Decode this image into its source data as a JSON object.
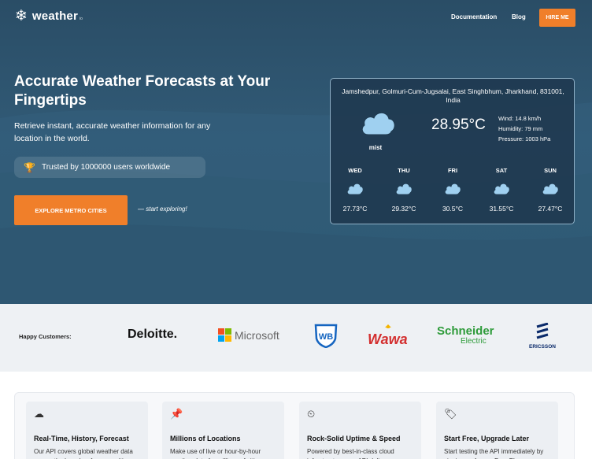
{
  "header": {
    "logo_text": "weather",
    "logo_suffix": "io",
    "nav": [
      "Documentation",
      "Blog"
    ],
    "cta": "HIRE ME"
  },
  "hero": {
    "title": "Accurate Weather Forecasts at Your Fingertips",
    "subtitle": "Retrieve instant, accurate weather information for any location in the world.",
    "trust_text": "Trusted by 1000000 users worldwide",
    "explore_button": "EXPLORE METRO CITIES",
    "explore_note": "— start exploring!"
  },
  "weather_card": {
    "location": "Jamshedpur, Golmuri-Cum-Jugsalai, East Singhbhum, Jharkhand, 831001, India",
    "condition": "mist",
    "temperature": "28.95°C",
    "wind": "Wind: 14.8 km/h",
    "humidity": "Humidity: 79 mm",
    "pressure": "Pressure: 1003 hPa",
    "forecast": [
      {
        "day": "WED",
        "temp": "27.73°C",
        "icon": "cloud-icon"
      },
      {
        "day": "THU",
        "temp": "29.32°C",
        "icon": "cloud-icon"
      },
      {
        "day": "FRI",
        "temp": "30.5°C",
        "icon": "cloud-icon"
      },
      {
        "day": "SAT",
        "temp": "31.55°C",
        "icon": "cloud-icon"
      },
      {
        "day": "SUN",
        "temp": "27.47°C",
        "icon": "cloud-icon"
      }
    ]
  },
  "customers": {
    "label": "Happy Customers:",
    "brands": [
      "Deloitte.",
      "Microsoft",
      "WB",
      "Wawa",
      "Schneider",
      "Electric",
      "ERICSSON"
    ]
  },
  "features": [
    {
      "icon": "cloud-clock-icon",
      "title": "Real-Time, History, Forecast",
      "desc": "Our API covers global weather data across the board — from a multi"
    },
    {
      "icon": "pin-icon",
      "title": "Millions of Locations",
      "desc": "Make use of live or hour-by-hour weather data for millions of cities"
    },
    {
      "icon": "gauge-icon",
      "title": "Rock-Solid Uptime & Speed",
      "desc": "Powered by best-in-class cloud infrastructure, our API delivers"
    },
    {
      "icon": "tag-icon",
      "title": "Start Free, Upgrade Later",
      "desc": "Start testing the API immediately by signing up for our Free Plan"
    }
  ],
  "colors": {
    "hero_bg": "#2e5670",
    "accent": "#f07f2a",
    "card_border": "#8fb0c6",
    "cloud": "#9fd0f0"
  }
}
